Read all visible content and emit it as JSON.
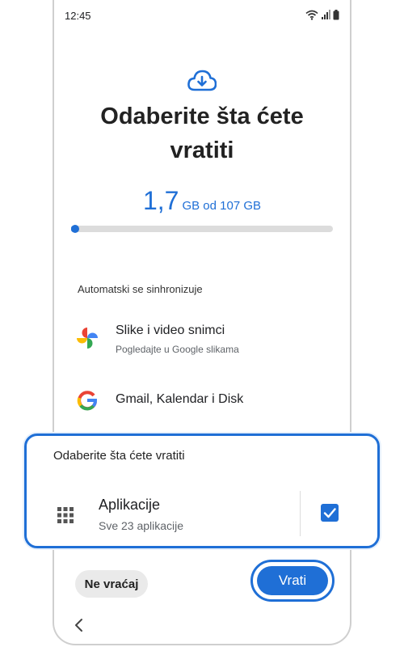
{
  "status_bar": {
    "time": "12:45",
    "icons": [
      "wifi-icon",
      "signal-icon",
      "battery-icon"
    ]
  },
  "header": {
    "icon": "cloud-download-icon",
    "title": "Odaberite šta ćete vratiti"
  },
  "storage": {
    "used": "1,7",
    "detail": "GB od 107 GB",
    "progress_percent": 2
  },
  "sync_section": {
    "label": "Automatski se sinhronizuje",
    "items": [
      {
        "icon": "google-photos-icon",
        "title": "Slike i video snimci",
        "subtitle": "Pogledajte u Google slikama"
      },
      {
        "icon": "google-icon",
        "title": "Gmail, Kalendar i Disk",
        "subtitle": ""
      }
    ]
  },
  "restore_card": {
    "title": "Odaberite šta ćete vratiti",
    "item": {
      "icon": "apps-grid-icon",
      "title": "Aplikacije",
      "subtitle": "Sve 23 aplikacije",
      "checked": true
    }
  },
  "actions": {
    "skip_label": "Ne vraćaj",
    "restore_label": "Vrati"
  },
  "nav": {
    "back_icon": "back-chevron-icon"
  },
  "colors": {
    "accent": "#1f6fd6",
    "track": "#dcdcdc",
    "secondary_button": "#eaeaea"
  }
}
